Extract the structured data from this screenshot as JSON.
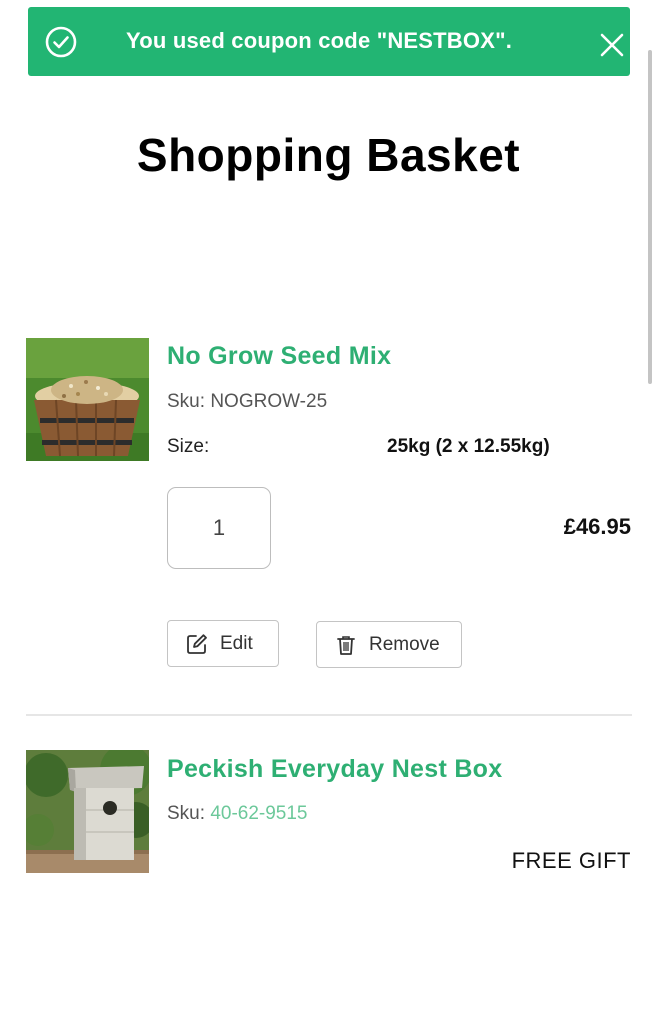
{
  "notice": {
    "message": "You used coupon code \"NESTBOX\".",
    "icon": "check-circle-icon",
    "close_icon": "close-icon",
    "color": "#22b573"
  },
  "page": {
    "title": "Shopping Basket"
  },
  "items": [
    {
      "name": "No Grow Seed Mix",
      "sku_label": "Sku:",
      "sku_value": "NOGROW-25",
      "size_label": "Size:",
      "size_value": "25kg (2 x 12.55kg)",
      "quantity": "1",
      "price": "£46.95",
      "edit_label": "Edit",
      "remove_label": "Remove",
      "image": "seed-mix-bucket-image"
    },
    {
      "name": "Peckish Everyday Nest Box",
      "sku_label": "Sku:",
      "sku_value": "40-62-9515",
      "price_note": "FREE GIFT",
      "image": "nest-box-image"
    }
  ],
  "colors": {
    "brand_green": "#2eaf73",
    "notice_green": "#22b573",
    "sku_link": "#6cc89a"
  }
}
